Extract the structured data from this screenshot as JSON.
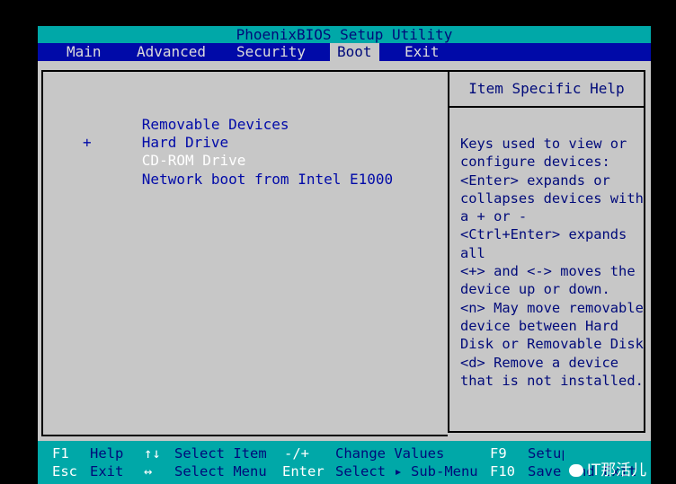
{
  "title": "PhoenixBIOS Setup Utility",
  "menu": [
    {
      "label": "Main",
      "active": false
    },
    {
      "label": "Advanced",
      "active": false
    },
    {
      "label": "Security",
      "active": false
    },
    {
      "label": "Boot",
      "active": true
    },
    {
      "label": "Exit",
      "active": false
    }
  ],
  "boot_items": [
    {
      "prefix": "",
      "label": "Removable Devices",
      "selected": false
    },
    {
      "prefix": "+",
      "label": "Hard Drive",
      "selected": false
    },
    {
      "prefix": "",
      "label": "CD-ROM Drive",
      "selected": true
    },
    {
      "prefix": "",
      "label": "Network boot from Intel E1000",
      "selected": false
    }
  ],
  "help": {
    "title": "Item Specific Help",
    "text": "Keys used to view or\nconfigure devices:\n<Enter> expands or\ncollapses devices with\na + or -\n<Ctrl+Enter> expands\nall\n<+> and <-> moves the\ndevice up or down.\n<n> May move removable\ndevice between Hard\nDisk or Removable Disk\n<d> Remove a device\nthat is not installed."
  },
  "status": {
    "row1": [
      {
        "key": "F1",
        "label": "Help"
      },
      {
        "key": "↑↓",
        "label": "Select Item"
      },
      {
        "key": "-/+",
        "label": "Change Values"
      },
      {
        "key": "F9",
        "label": "Setup Defaults"
      }
    ],
    "row2": [
      {
        "key": "Esc",
        "label": "Exit"
      },
      {
        "key": "↔",
        "label": "Select Menu"
      },
      {
        "key": "Enter",
        "label": "Select ▸ Sub-Menu"
      },
      {
        "key": "F10",
        "label": "Save and Exit"
      }
    ]
  },
  "watermark": "IT那活儿",
  "colors": {
    "title_bg": "#00a8a8",
    "menu_bg": "#000aa8",
    "panel_bg": "#c7c7c7",
    "item_text": "#000aa8",
    "selected_text": "#ffffff"
  }
}
